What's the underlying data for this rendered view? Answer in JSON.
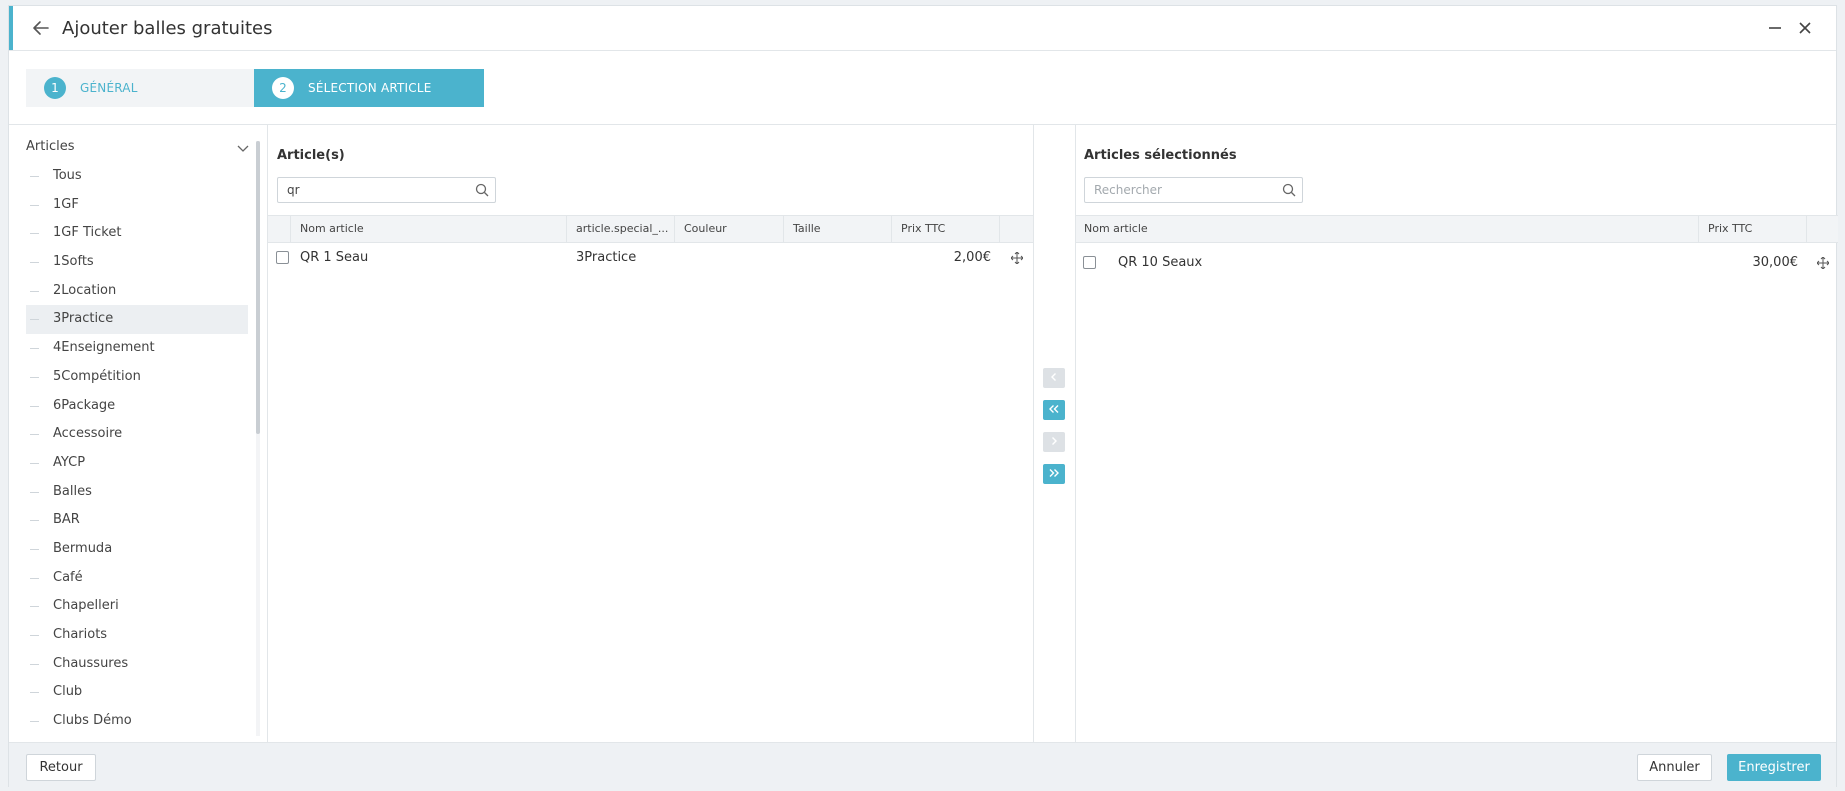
{
  "colors": {
    "accent": "#4bb3cd",
    "border": "#e2e6e9",
    "panel": "#f2f4f6"
  },
  "header": {
    "title": "Ajouter balles gratuites"
  },
  "steps": [
    {
      "number": "1",
      "label": "GÉNÉRAL"
    },
    {
      "number": "2",
      "label": "SÉLECTION ARTICLE"
    }
  ],
  "tree": {
    "root": "Articles",
    "items": [
      "Tous",
      "1GF",
      "1GF Ticket",
      "1Softs",
      "2Location",
      "3Practice",
      "4Enseignement",
      "5Compétition",
      "6Package",
      "Accessoire",
      "AYCP",
      "Balles",
      "BAR",
      "Bermuda",
      "Café",
      "Chapelleri",
      "Chariots",
      "Chaussures",
      "Club",
      "Clubs Démo"
    ],
    "selected": "3Practice"
  },
  "left_panel": {
    "title": "Article(s)",
    "search_value": "qr",
    "columns": [
      "Nom article",
      "article.special_...",
      "Couleur",
      "Taille",
      "Prix TTC"
    ],
    "rows": [
      {
        "name": "QR 1 Seau",
        "special": "3Practice",
        "couleur": "",
        "taille": "",
        "prix": "2,00€"
      }
    ]
  },
  "right_panel": {
    "title": "Articles sélectionnés",
    "search_placeholder": "Rechercher",
    "columns": [
      "Nom article",
      "Prix TTC"
    ],
    "rows": [
      {
        "name": "QR 10 Seaux",
        "prix": "30,00€"
      }
    ]
  },
  "transfer_buttons": [
    {
      "icon": "chevron-left-icon",
      "enabled": false
    },
    {
      "icon": "double-chevron-left-icon",
      "enabled": true
    },
    {
      "icon": "chevron-right-icon",
      "enabled": false
    },
    {
      "icon": "double-chevron-right-icon",
      "enabled": true
    }
  ],
  "footer": {
    "back_label": "Retour",
    "cancel_label": "Annuler",
    "save_label": "Enregistrer"
  }
}
